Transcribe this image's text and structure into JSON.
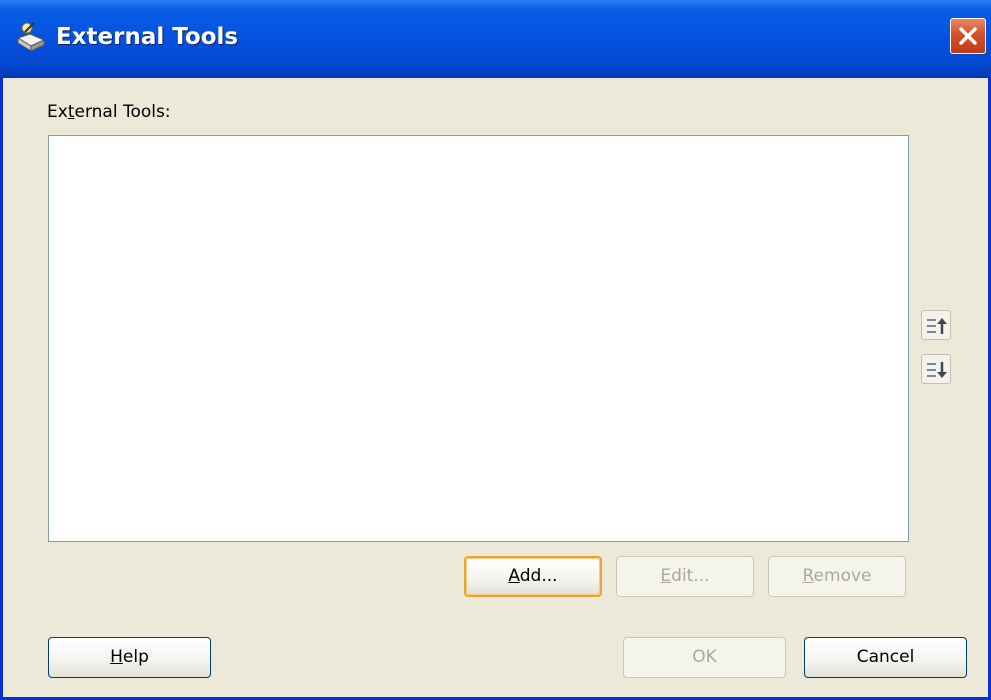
{
  "window": {
    "title": "External Tools",
    "icons": {
      "app": "external-tools-icon",
      "close": "close-icon"
    }
  },
  "tools_list": {
    "label_pre": "Ex",
    "label_mnemonic": "t",
    "label_post": "ernal Tools:",
    "items": []
  },
  "reorder": {
    "move_up_icon": "move-up-icon",
    "move_down_icon": "move-down-icon"
  },
  "actions": {
    "add": {
      "mnemonic": "A",
      "rest": "dd..."
    },
    "edit": {
      "mnemonic": "E",
      "rest": "dit..."
    },
    "remove": {
      "mnemonic": "R",
      "rest": "emove"
    }
  },
  "footer": {
    "help": {
      "mnemonic": "H",
      "rest": "elp"
    },
    "ok": "OK",
    "cancel": "Cancel"
  },
  "colors": {
    "title_bar": "#0451de",
    "dialog_bg": "#ece9d8",
    "close_button": "#d4512c",
    "default_button_border": "#e8a33a"
  }
}
